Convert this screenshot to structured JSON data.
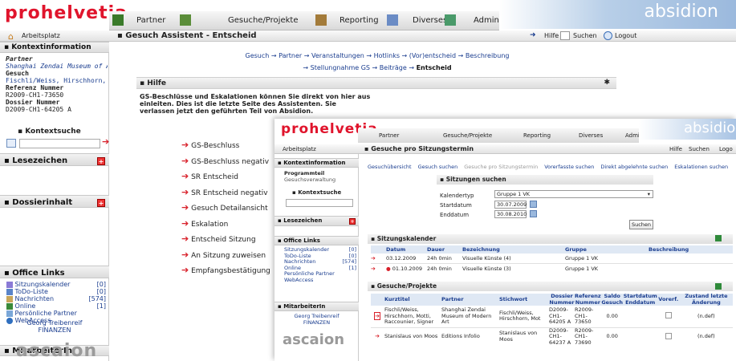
{
  "brand": {
    "logo": "prohelvetia",
    "absidion": "absidion",
    "footer": "ascaion"
  },
  "topnav": {
    "items": [
      {
        "label": "Partner"
      },
      {
        "label": "Gesuche/Projekte"
      },
      {
        "label": "Reporting"
      },
      {
        "label": "Diverses"
      },
      {
        "label": "Admin."
      }
    ]
  },
  "utility": {
    "help": "Hilfe",
    "search": "Suchen",
    "logout": "Logout"
  },
  "breadcrumb": {
    "home": "Arbeitsplatz",
    "page_title": "Gesuch Assistent - Entscheid"
  },
  "sidebar": {
    "kontext_title": "Kontextinformation",
    "kontext": {
      "partner_label": "Partner",
      "partner_value": "Shanghai Zendai Museum of A",
      "gesuch_label": "Gesuch",
      "gesuch_value": "Fischli/Weiss, Hirschhorn, M",
      "referenz_label": "Referenz Nummer",
      "referenz_value": "R2009-CH1-73650",
      "dossier_label": "Dossier Nummer",
      "dossier_value": "D2009-CH1-64205 A"
    },
    "kontextsuche_title": "Kontextsuche",
    "lesezeichen_title": "Lesezeichen",
    "dossierinhalt_title": "Dossierinhalt",
    "office_links_title": "Office Links",
    "office_links": [
      {
        "label": "Sitzungskalender",
        "count": "[0]"
      },
      {
        "label": "ToDo-Liste",
        "count": "[0]"
      },
      {
        "label": "Nachrichten",
        "count": "[574]"
      },
      {
        "label": "Online",
        "count": "[1]"
      },
      {
        "label": "Persönliche Partner",
        "count": ""
      },
      {
        "label": "WebAccess",
        "count": ""
      }
    ],
    "mitarbeiter_title": "MitarbeiterIn",
    "mitarbeiter_name": "Georg Treibenreif",
    "mitarbeiter_dept": "FINANZEN"
  },
  "wizard": {
    "steps": [
      "Gesuch",
      "Partner",
      "Veranstaltungen",
      "Hotlinks",
      "(Vor)entscheid",
      "Beschreibung",
      "Stellungnahme GS",
      "Beiträge",
      "Entscheid"
    ],
    "hilfe_title": "Hilfe",
    "hilfe_text": "GS-Beschlüsse und Eskalationen können Sie direkt von hier aus einleiten. Dies ist die letzte Seite des Assistenten. Sie verlassen jetzt den geführten Teil von Absidion.",
    "actions": [
      "GS-Beschluss",
      "GS-Beschluss negativ",
      "SR Entscheid",
      "SR Entscheid negativ",
      "Gesuch Detailansicht",
      "Eskalation",
      "Entscheid Sitzung",
      "An Sitzung zuweisen",
      "Empfangsbestätigung"
    ]
  },
  "overlay": {
    "logo": "prohelvetia",
    "absidion": "absidion",
    "nav": [
      "Partner",
      "Gesuche/Projekte",
      "Reporting",
      "Diverses",
      "Admin."
    ],
    "utility": {
      "help": "Hilfe",
      "search": "Suchen",
      "logout": "Logo"
    },
    "home": "Arbeitsplatz",
    "page_title": "Gesuche pro Sitzungstermin",
    "kontext_title": "Kontextinformation",
    "programmteil_label": "Programmteil",
    "programmteil_value": "Gesuchsverwaltung",
    "kontextsuche_title": "Kontextsuche",
    "lesezeichen_title": "Lesezeichen",
    "office_links_title": "Office Links",
    "office_links": [
      {
        "label": "Sitzungskalender",
        "count": "[0]"
      },
      {
        "label": "ToDo-Liste",
        "count": "[0]"
      },
      {
        "label": "Nachrichten",
        "count": "[574]"
      },
      {
        "label": "Online",
        "count": "[1]"
      },
      {
        "label": "Persönliche Partner",
        "count": ""
      },
      {
        "label": "WebAccess",
        "count": ""
      }
    ],
    "mitarbeiter_title": "MitarbeiterIn",
    "mitarbeiter_name": "Georg Treibenreif",
    "mitarbeiter_dept": "FINANZEN",
    "footer": "ascaion",
    "tabs": [
      "Gesuchübersicht",
      "Gesuch suchen",
      "Gesuche pro Sitzungstermin",
      "Vorerfasste suchen",
      "Direkt abgelehnte suchen",
      "Eskalationen suchen"
    ],
    "search_title": "Sitzungen suchen",
    "kalendertyp_label": "Kalendertyp",
    "kalendertyp_value": "Gruppe 1 VK",
    "startdatum_label": "Startdatum",
    "startdatum_value": "30.07.2009",
    "enddatum_label": "Enddatum",
    "enddatum_value": "30.08.2010",
    "search_button": "Suchen",
    "kalender_title": "Sitzungskalender",
    "kalender_headers": [
      "Datum",
      "Dauer",
      "Bezeichnung",
      "Gruppe",
      "Beschreibung"
    ],
    "kalender_rows": [
      [
        "03.12.2009",
        "24h 0min",
        "Visuelle Künste (4)",
        "Gruppe 1 VK",
        ""
      ],
      [
        "01.10.2009",
        "24h 0min",
        "Visuelle Künste (3)",
        "Gruppe 1 VK",
        ""
      ]
    ],
    "projekte_title": "Gesuche/Projekte",
    "projekte_headers": [
      "Kurztitel",
      "Partner",
      "Stichwort",
      "Dossier Nummer",
      "Referenz Nummer",
      "Saldo Gesuch",
      "Startdatum Enddatum",
      "Vorerf.",
      "Zustand letzte Änderung"
    ],
    "projekte_rows": [
      [
        "Fischli/Weiss, Hirschhorn, Motti, Raccounier, Signer",
        "Shanghai Zendai Museum of Modern Art",
        "Fischli/Weiss, Hirschhorn, Mot",
        "D2009-CH1-64205 A",
        "R2009-CH1-73650",
        "0.00",
        "",
        "",
        "(n.def)"
      ],
      [
        "Stanislaus von Moos",
        "Editions Infolio",
        "Stanislaus von Moos",
        "D2009-CH1-64237 A",
        "R2009-CH1-73690",
        "0.00",
        "",
        "",
        "(n.def)"
      ]
    ]
  }
}
